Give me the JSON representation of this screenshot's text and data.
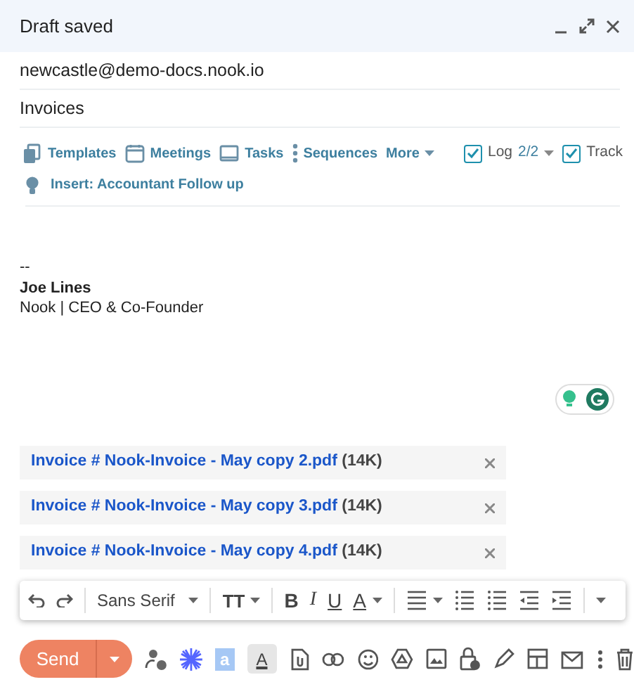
{
  "window": {
    "title": "Draft saved"
  },
  "to": {
    "value": "newcastle@demo-docs.nook.io"
  },
  "subject": {
    "value": "Invoices"
  },
  "tools": [
    {
      "label": "Templates",
      "kind": "templates"
    },
    {
      "label": "Meetings",
      "kind": "meetings"
    },
    {
      "label": "Tasks",
      "kind": "tasks"
    },
    {
      "label": "Sequences",
      "kind": "sequences"
    }
  ],
  "more": {
    "label": "More"
  },
  "log": {
    "label": "Log",
    "count": "2/2",
    "checked": true
  },
  "track": {
    "label": "Track",
    "checked": true
  },
  "insert": {
    "label": "Insert: Accountant Follow up"
  },
  "signature": {
    "separator": "--",
    "name": "Joe Lines",
    "title": "Nook | CEO & Co-Founder"
  },
  "attachments": [
    {
      "name": "Invoice # Nook-Invoice - May copy 2.pdf",
      "size": "(14K)"
    },
    {
      "name": "Invoice # Nook-Invoice - May copy 3.pdf",
      "size": "(14K)"
    },
    {
      "name": "Invoice # Nook-Invoice - May copy 4.pdf",
      "size": "(14K)"
    }
  ],
  "format_toolbar": {
    "font": "Sans Serif",
    "size": "TT",
    "bold": "B",
    "italic": "I",
    "underline": "U",
    "text_color": "A"
  },
  "send": {
    "label": "Send"
  },
  "bottom_toolbar": {
    "label_icon": "a",
    "formatting": "A",
    "formatting_on": true
  }
}
